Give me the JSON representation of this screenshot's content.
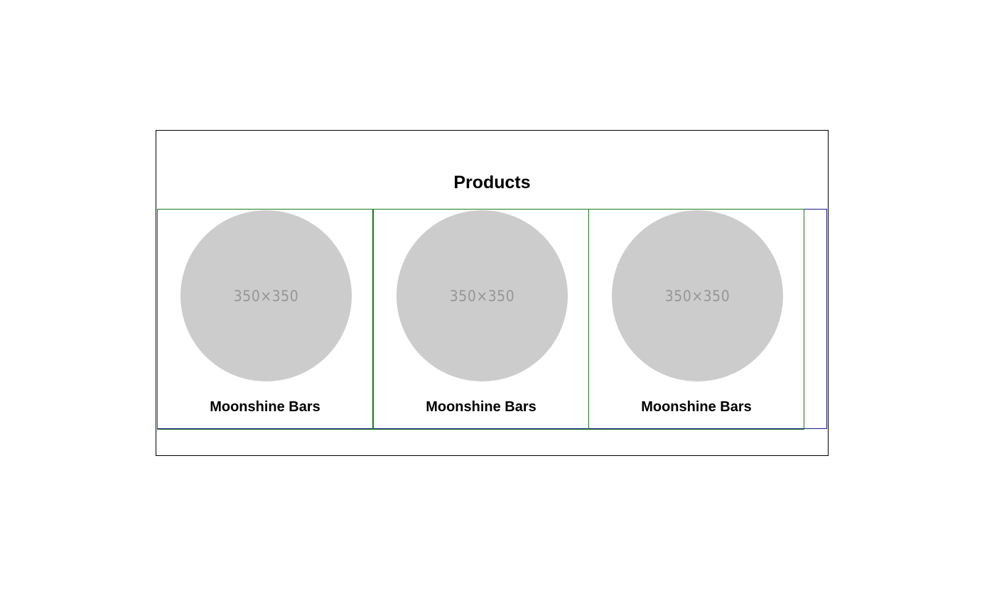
{
  "section": {
    "title": "Products"
  },
  "products": [
    {
      "image_label": "350×350",
      "name": "Moonshine Bars"
    },
    {
      "image_label": "350×350",
      "name": "Moonshine Bars"
    },
    {
      "image_label": "350×350",
      "name": "Moonshine Bars"
    }
  ],
  "colors": {
    "section_border": "#000000",
    "row_border": "#1a1a8c",
    "card_border": "#1a7a1a",
    "placeholder_bg": "#cccccc",
    "placeholder_text": "#969696"
  }
}
